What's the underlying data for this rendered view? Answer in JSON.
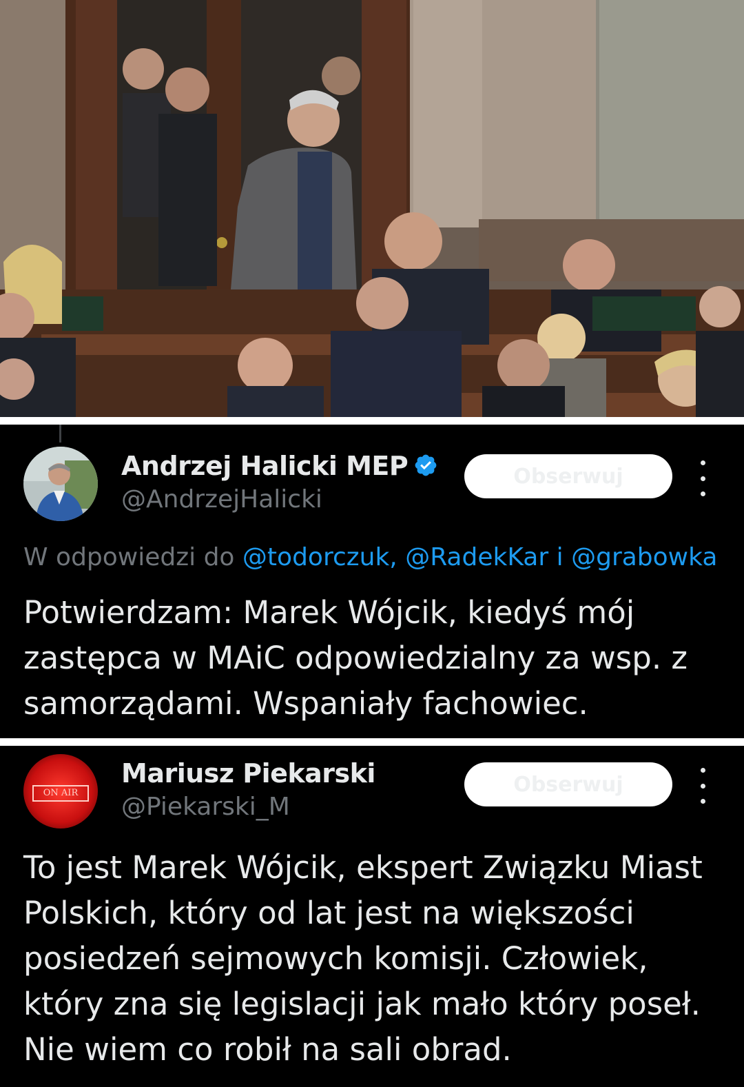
{
  "tweets": [
    {
      "display_name": "Andrzej Halicki MEP",
      "handle": "@AndrzejHalicki",
      "follow_label": "Obserwuj",
      "reply_prefix": "W odpowiedzi do",
      "reply_mentions_1": "@todorczuk,",
      "reply_mentions_2": "@RadekKar",
      "reply_and": "i",
      "reply_mentions_3": "@grabowka",
      "text": "Potwierdzam: Marek Wójcik, kiedyś mój\nzastępca w MAiC odpowiedzialny za wsp. z\nsamorządami. Wspaniały fachowiec."
    },
    {
      "display_name": "Mariusz Piekarski",
      "handle": "@Piekarski_M",
      "follow_label": "Obserwuj",
      "avatar_sign": "ON AIR",
      "text": "To jest Marek Wójcik, ekspert Związku Miast\nPolskich, który od lat jest na większości\nposiedzeń sejmowych komisji. Człowiek,\nktóry zna się legislacji jak mało który poseł.\nNie wiem co robił na sali obrad."
    }
  ],
  "colors": {
    "background": "#000000",
    "text_primary": "#e7e9ea",
    "text_secondary": "#71767b",
    "link": "#1d9bf0",
    "verified": "#1d9bf0"
  },
  "icons": [
    "verified-badge-icon",
    "more-options-icon"
  ]
}
